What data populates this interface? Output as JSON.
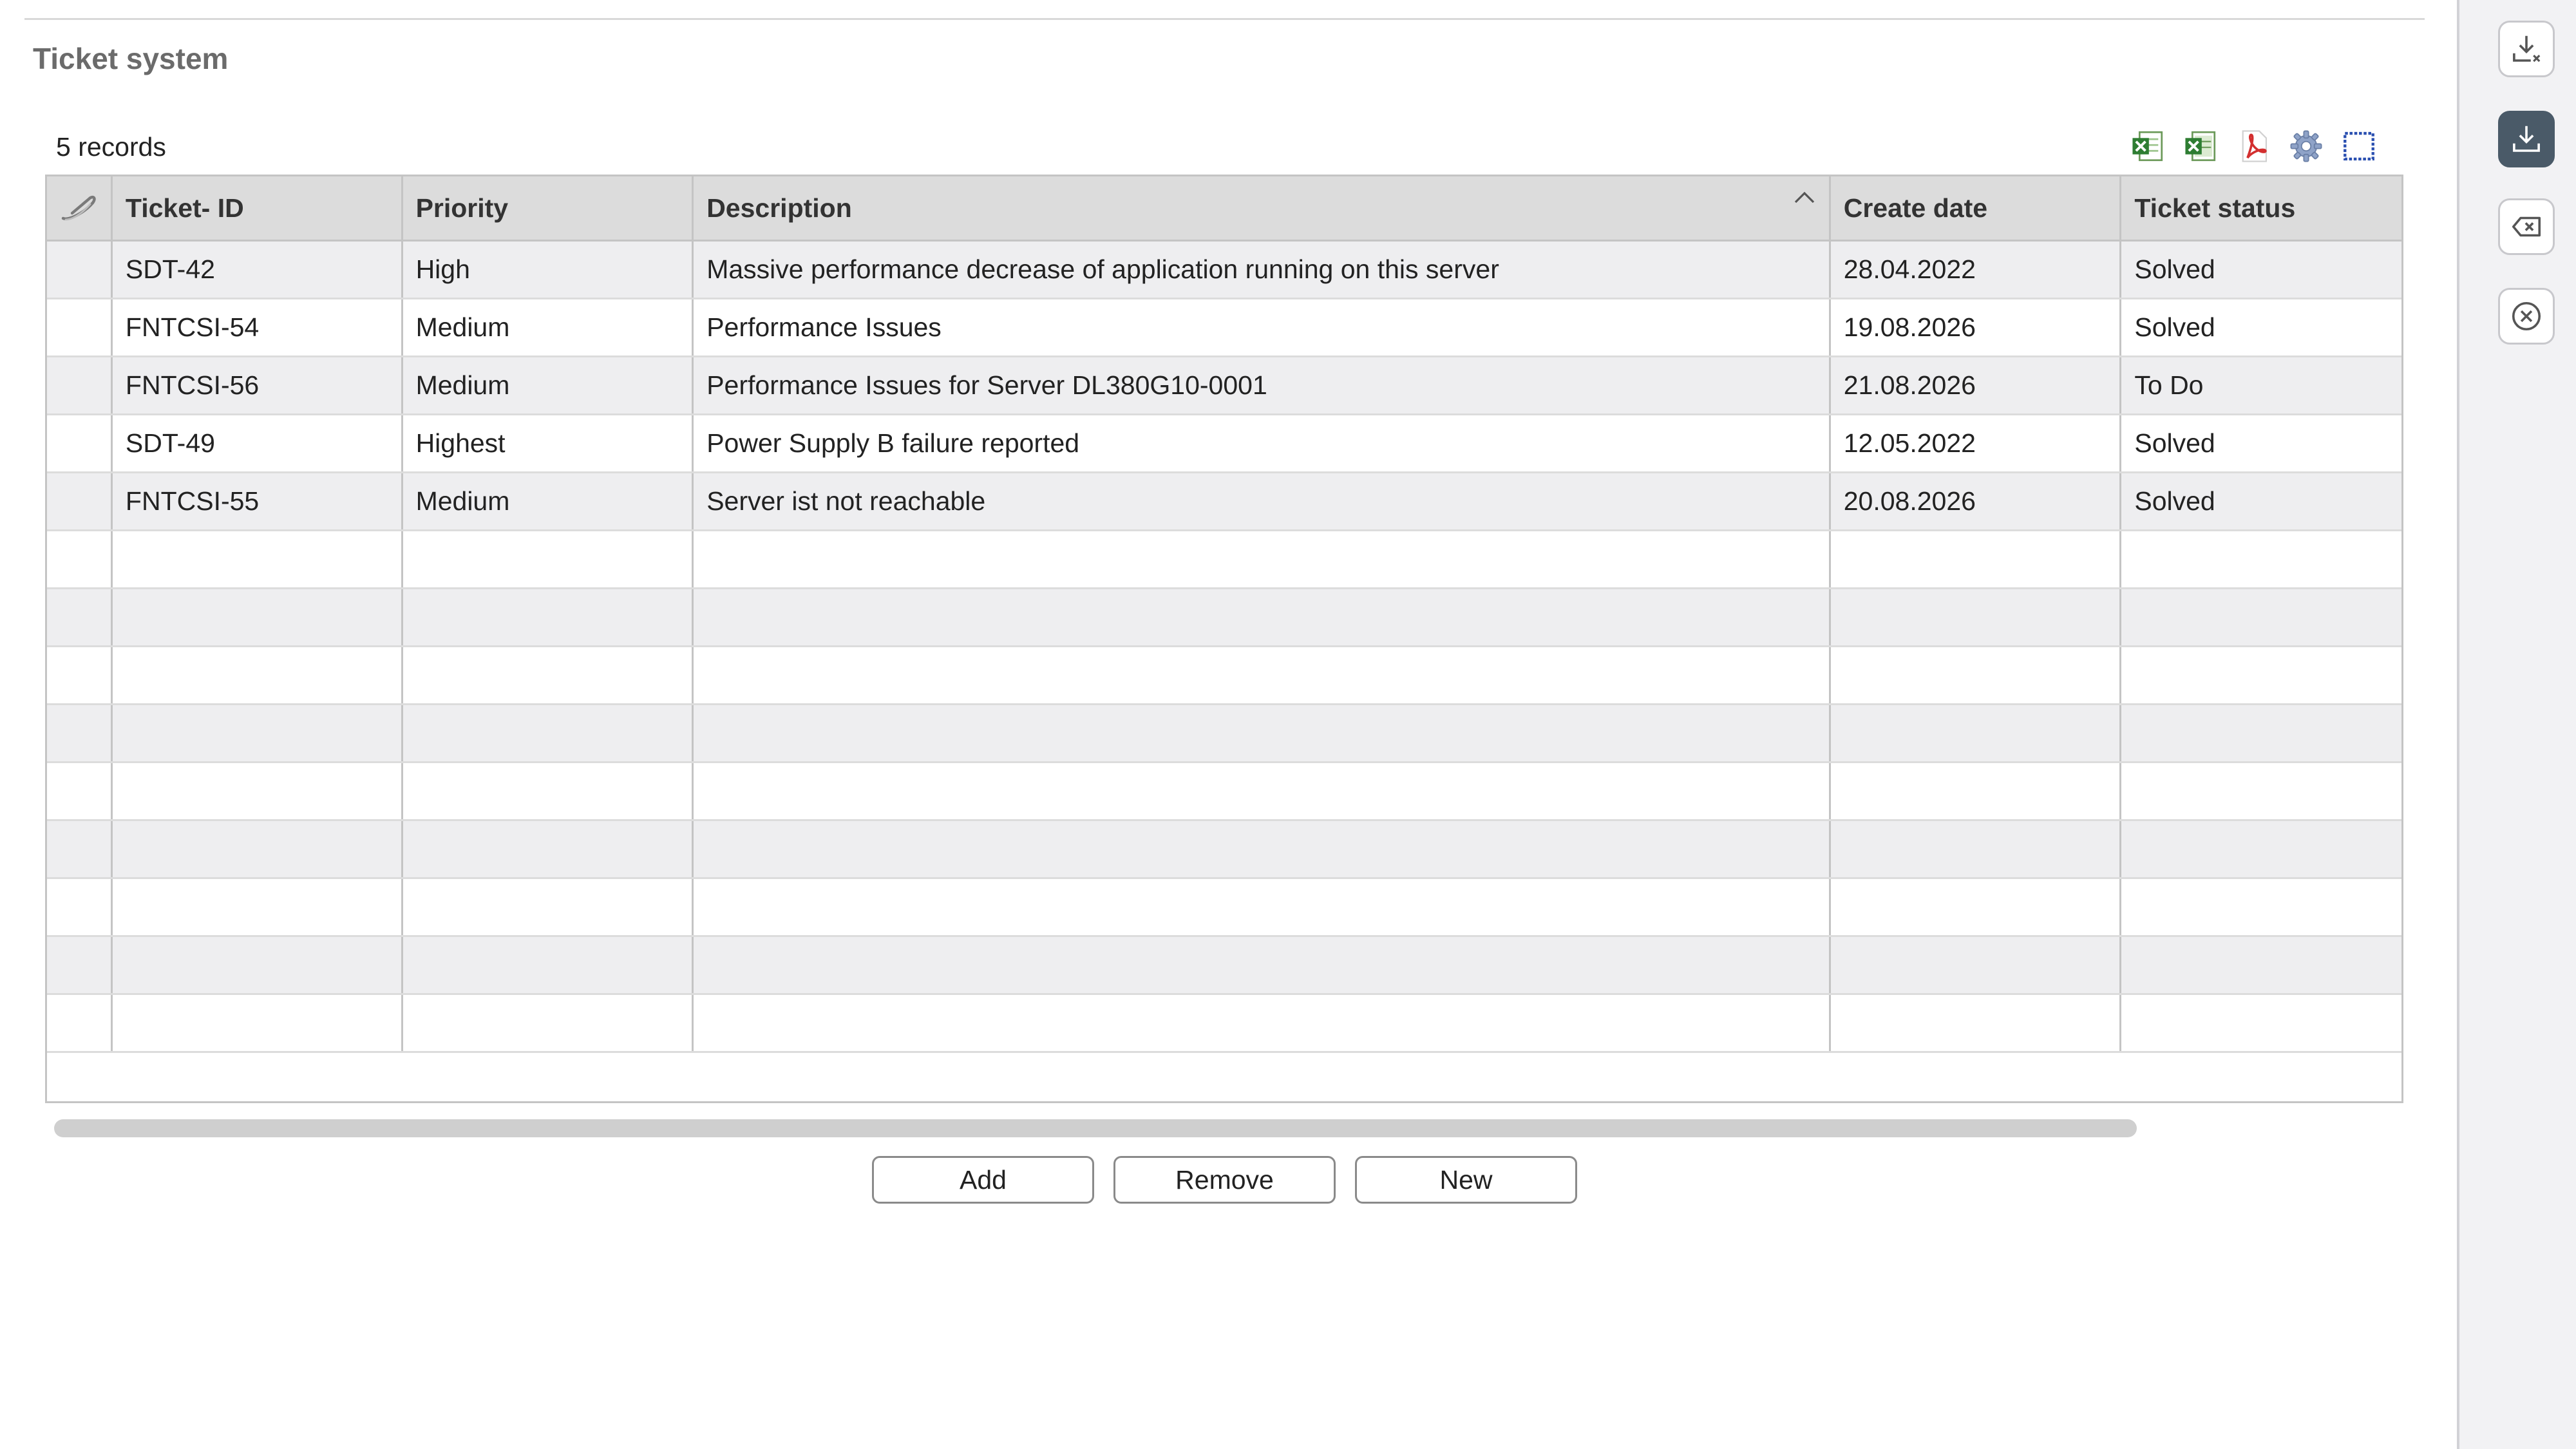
{
  "panel": {
    "title": "Ticket system",
    "record_count": "5 records"
  },
  "toolbar": {
    "icons": [
      "excel-export-icon",
      "excel-export-all-icon",
      "pdf-export-icon",
      "settings-gear-icon",
      "select-frame-icon"
    ]
  },
  "table": {
    "columns": [
      "Ticket- ID",
      "Priority",
      "Description",
      "Create date",
      "Ticket status"
    ],
    "sorted_column": "Description",
    "rows": [
      {
        "id": "SDT-42",
        "priority": "High",
        "description": "Massive performance decrease of application running on this server",
        "date": "28.04.2022",
        "status": "Solved"
      },
      {
        "id": "FNTCSI-54",
        "priority": "Medium",
        "description": "Performance Issues",
        "date": "19.08.2026",
        "status": "Solved"
      },
      {
        "id": "FNTCSI-56",
        "priority": "Medium",
        "description": "Performance Issues for Server DL380G10-0001",
        "date": "21.08.2026",
        "status": "To Do"
      },
      {
        "id": "SDT-49",
        "priority": "Highest",
        "description": "Power Supply B failure reported",
        "date": "12.05.2022",
        "status": "Solved"
      },
      {
        "id": "FNTCSI-55",
        "priority": "Medium",
        "description": "Server ist not reachable",
        "date": "20.08.2026",
        "status": "Solved"
      }
    ]
  },
  "actions": {
    "add": "Add",
    "remove": "Remove",
    "new": "New"
  },
  "sidebar": {
    "buttons": [
      "download-clear-icon",
      "download-icon",
      "backspace-icon",
      "close-circle-icon"
    ],
    "active": "download-icon"
  },
  "colors": {
    "accent": "#4a5a68",
    "header_bg": "#dcdcdc",
    "row_alt": "#eeeef0"
  }
}
